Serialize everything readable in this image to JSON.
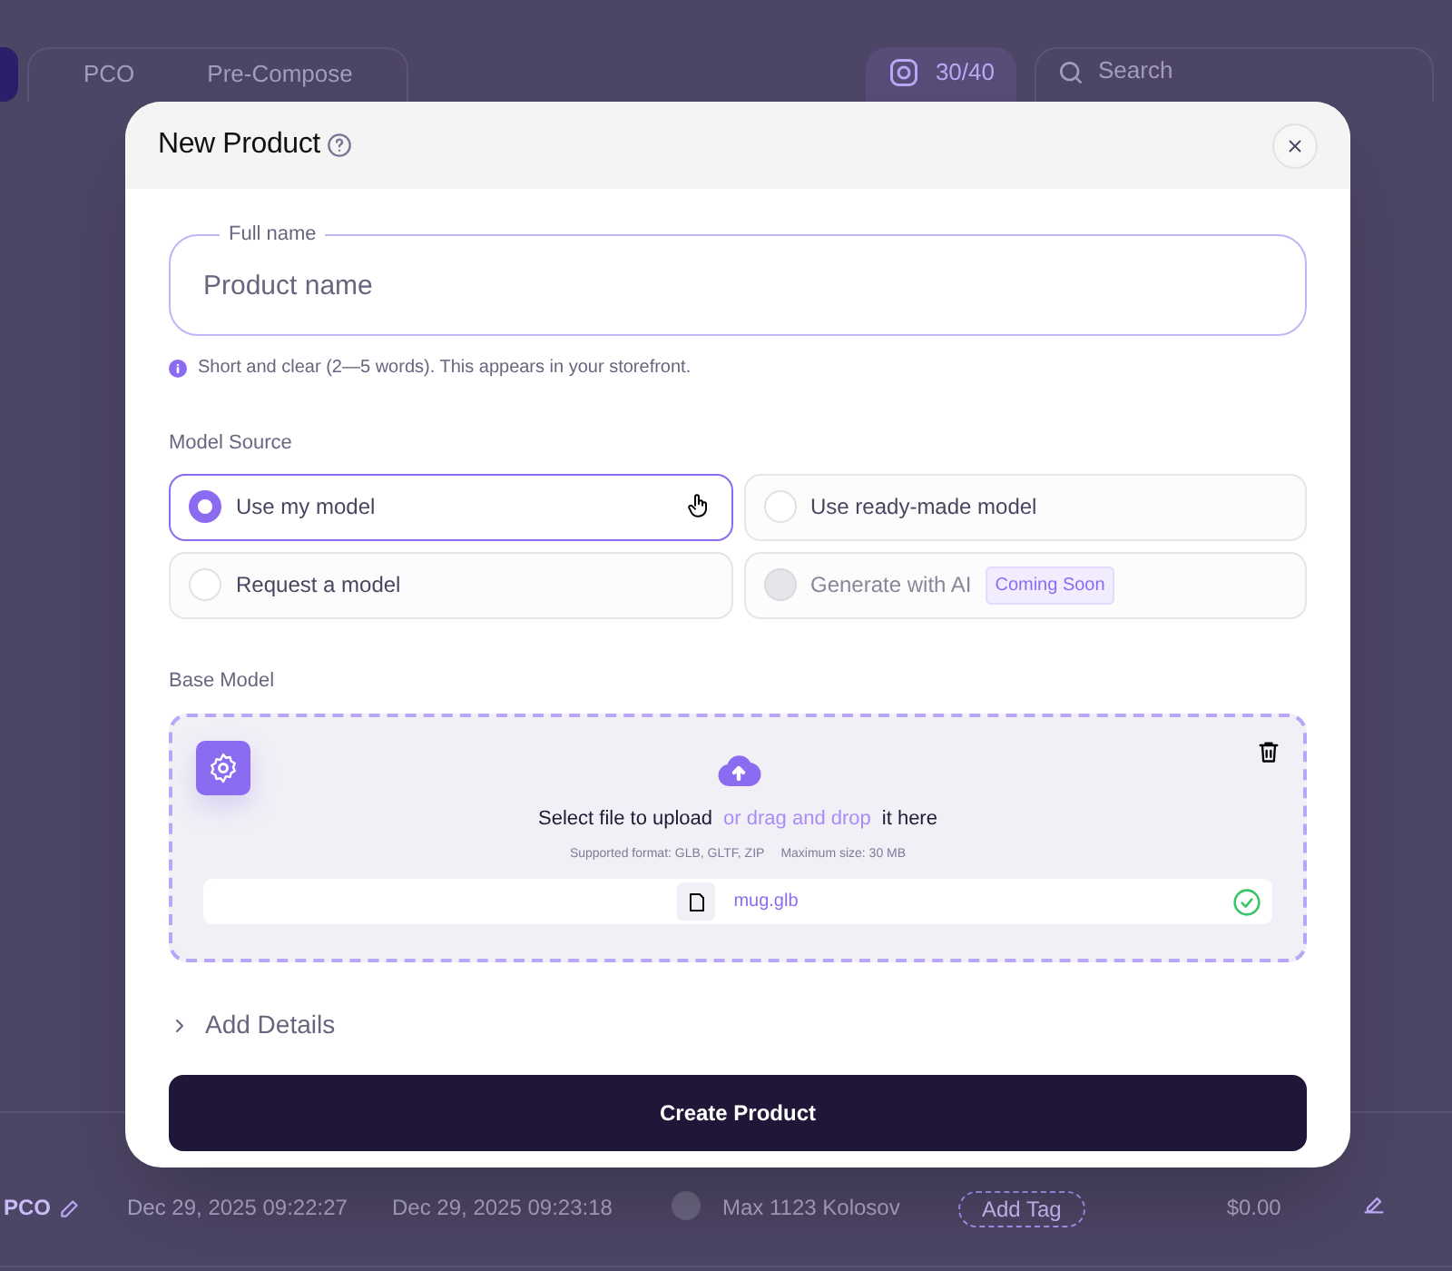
{
  "background": {
    "tabs": [
      {
        "label": "PCO",
        "selected": false
      },
      {
        "label": "Pre-Compose",
        "selected": false
      }
    ],
    "counter": "30/40",
    "search": {
      "placeholder": "Search"
    },
    "row": {
      "name": "PCO",
      "created": "Dec 29, 2025 09:22:27",
      "updated": "Dec 29, 2025 09:23:18",
      "user": "Max 1123 Kolosov",
      "tag": "Add Tag",
      "price": "$0.00"
    }
  },
  "modal": {
    "title": "New Product",
    "full_name": {
      "label": "Full name",
      "placeholder": "Product name",
      "hint": "Short and clear (2—5 words). This appears in your storefront."
    },
    "model_source": {
      "label": "Model Source",
      "options": [
        {
          "label": "Use my model",
          "selected": true,
          "disabled": false
        },
        {
          "label": "Use ready-made model",
          "selected": false,
          "disabled": false
        },
        {
          "label": "Request a model",
          "selected": false,
          "disabled": false
        },
        {
          "label": "Generate with AI",
          "selected": false,
          "disabled": true,
          "badge": "Coming Soon"
        }
      ]
    },
    "base_model": {
      "label": "Base Model",
      "upload_text": "Select file to upload",
      "upload_link": "or drag and drop",
      "upload_suffix": "it here",
      "formats": "Supported format: GLB, GLTF, ZIP",
      "max_size": "Maximum size: 30 MB",
      "file": {
        "name": "mug.glb",
        "uploaded": true
      }
    },
    "add_details": {
      "label": "Add Details",
      "expanded": false
    },
    "submit": "Create Product"
  }
}
